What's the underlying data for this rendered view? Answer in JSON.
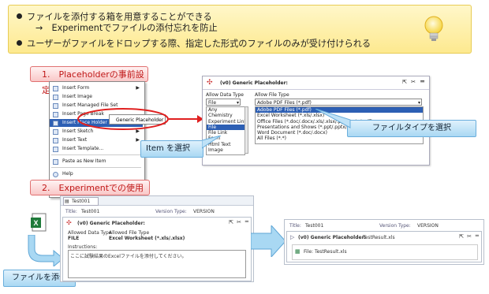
{
  "banner": {
    "bullet1": "ファイルを添付する箱を用意することができる",
    "bullet1_sub": "→　Experimentでファイルの添付忘れを防止",
    "bullet2": "ユーザーがファイルをドロップする際、指定した形式のファイルのみが受け付けられる",
    "icon": "lightbulb-icon"
  },
  "section1": {
    "label": "1.　Placeholderの事前設定"
  },
  "section2": {
    "label": "2.　Experimentでの使用"
  },
  "context_menu": {
    "items": [
      {
        "label": "Insert Form",
        "arrow": "▶"
      },
      {
        "label": "Insert Image",
        "arrow": ""
      },
      {
        "label": "Insert Managed File Set",
        "arrow": ""
      },
      {
        "label": "Insert Page Break",
        "arrow": ""
      },
      {
        "label": "Insert Place Holder",
        "arrow": "▶"
      },
      {
        "label": "Insert Sketch",
        "arrow": "▶"
      },
      {
        "label": "Insert Text",
        "arrow": "▶"
      },
      {
        "label": "Insert Template...",
        "arrow": ""
      },
      {
        "label": "Paste as New Item",
        "arrow": ""
      },
      {
        "label": "Help",
        "arrow": ""
      }
    ],
    "submenu_item": "Generic Placeholder"
  },
  "placeholder_dialog": {
    "title": "(v0) Generic Placeholder:",
    "data_type_label": "Allow Data Type",
    "data_type_value": "File",
    "data_types": [
      "Any",
      "Chemistry",
      "Experiment Link",
      "File",
      "File Link",
      "Form",
      "Html Text",
      "Image"
    ],
    "file_type_label": "Allow File Type",
    "file_type_value": "Adobe PDF Files (*.pdf)",
    "file_types": [
      "Adobe PDF Files (*.pdf)",
      "Excel Worksheet (*.xls/.xlsx)",
      "Office Files (*.doc/.docx/.xls/.xlsx/.ppt/.pptx/.pdf)",
      "Presentations and Shows (*.ppt/.pptx/.pps)",
      "Word Document (*.doc/.docx)",
      "All Files (*.*)"
    ]
  },
  "callouts": {
    "file_type": "ファイルタイプを選択",
    "item": "Item を選択",
    "attach": "ファイルを添付"
  },
  "experiment_left": {
    "tab": "Test001",
    "title_label": "Title:",
    "title_value": "Test001",
    "version_label": "Version Type:",
    "version_value": "VERSION",
    "panel_title": "(v0) Generic Placeholder:",
    "allowed_data_type_label": "Allowed Data Type",
    "allowed_file_type_label": "Allowed File Type",
    "data_type_value": "FILE",
    "file_type_value": "Excel Worksheet (*.xls/.xlsx)",
    "instructions_label": "Instructions:",
    "instructions_text": "ここに試験結果のExcelファイルを添付してください。"
  },
  "experiment_right": {
    "title_label": "Title:",
    "title_value": "Test001",
    "version_label": "Version Type:",
    "version_value": "VERSION",
    "panel_title": "(v0) Generic Placeholder:",
    "panel_file": "TestResult.xls",
    "file_label": "File: TestResult.xls"
  },
  "colors": {
    "banner_bg": "#fde98f",
    "tag_text": "#c01818",
    "select_blue": "#2d5fb4",
    "callout_blue": "#a9d8f3",
    "arrow_red": "#e02020"
  }
}
